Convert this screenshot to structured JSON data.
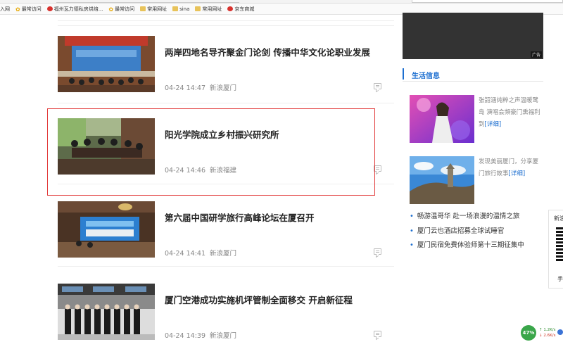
{
  "browser": {
    "bookmarks": [
      {
        "label": "入网",
        "icon": "none"
      },
      {
        "label": "最常访问",
        "icon": "star-icon"
      },
      {
        "label": "福州瓦力德私房烘焙...",
        "icon": "weibo-icon"
      },
      {
        "label": "最常访问",
        "icon": "star-icon"
      },
      {
        "label": "常用网址",
        "icon": "folder-icon"
      },
      {
        "label": "sina",
        "icon": "folder-icon"
      },
      {
        "label": "常用网址",
        "icon": "folder-icon"
      },
      {
        "label": "京东商城",
        "icon": "jd-icon"
      }
    ]
  },
  "feed": {
    "items": [
      {
        "title": "两岸四地名导齐聚金门论剑 传播中华文化论职业发展",
        "time": "04-24 14:47",
        "source": "新浪厦门"
      },
      {
        "title": "阳光学院成立乡村振兴研究所",
        "time": "04-24 14:46",
        "source": "新浪福建"
      },
      {
        "title": "第六届中国研学旅行高峰论坛在厦召开",
        "time": "04-24 14:41",
        "source": "新浪厦门"
      },
      {
        "title": "厦门空港成功实施机坪管制全面移交 开启新征程",
        "time": "04-24 14:39",
        "source": "新浪厦门"
      }
    ]
  },
  "sidebar": {
    "ad_tag": "广告",
    "life_title": "生活信息",
    "cards": [
      {
        "text": "张韶涵纯粹之声温暖鹭岛 演唱会頻豪门熏福利到",
        "more": "[详细]"
      },
      {
        "text": "发现美丽厦门，分享厦门旅行故事",
        "more": "[详细]"
      }
    ],
    "links": [
      "畅游温哥华 赴一场浪漫的温情之旅",
      "厦门云也酒店招募全球试睡官",
      "厦门民宿免费体验师第十三期征集中"
    ]
  },
  "qr_panel": {
    "top_text": "新浪",
    "bottom_text": "手"
  },
  "speed_widget": {
    "percent": "47%",
    "up": "↑ 1.2K/s",
    "down": "↓ 2.6K/s"
  },
  "colors": {
    "accent": "#1d6fd0",
    "highlight": "#e23b3b"
  }
}
